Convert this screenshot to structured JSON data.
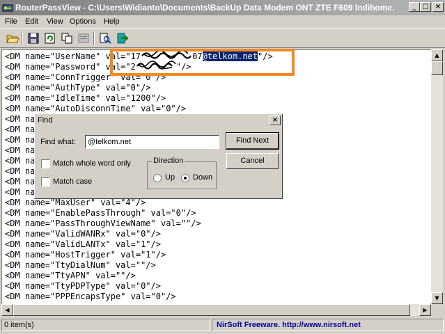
{
  "window": {
    "title": "RouterPassView  -  C:\\Users\\Widianto\\Documents\\BackUp Data Modem ONT ZTE F609  Indihome..."
  },
  "menu": [
    "File",
    "Edit",
    "View",
    "Options",
    "Help"
  ],
  "toolbar_icons": [
    "open-folder-icon",
    "save-icon",
    "refresh-icon",
    "copy-icon",
    "properties-icon",
    "find-icon",
    "exit-icon"
  ],
  "code_lines": [
    {
      "pre": "<DM name=\"UserName\" val=\"17",
      "post": "07",
      "match": "@telkom.net",
      "tail": "\"/>"
    },
    {
      "pre": "<DM name=\"Password\" val=\"2",
      "post": "",
      "match": "",
      "tail": "\"/>"
    },
    {
      "text": "<DM name=\"ConnTrigger\" val=\"0\"/>"
    },
    {
      "text": "<DM name=\"AuthType\" val=\"0\"/>"
    },
    {
      "text": "<DM name=\"IdleTime\" val=\"1200\"/>"
    },
    {
      "text": "<DM name=\"AutoDisconnTime\" val=\"0\"/>"
    },
    {
      "text": "<DM na"
    },
    {
      "text": "<DM na"
    },
    {
      "text": "<DM na"
    },
    {
      "text": "<DM na"
    },
    {
      "text": "<DM na"
    },
    {
      "text": "<DM na"
    },
    {
      "text": "<DM na"
    },
    {
      "text": "<DM na"
    },
    {
      "text": "<DM name=\"MaxUser\" val=\"4\"/>"
    },
    {
      "text": "<DM name=\"EnablePassThrough\" val=\"0\"/>"
    },
    {
      "text": "<DM name=\"PassThroughViewName\" val=\"\"/>"
    },
    {
      "text": "<DM name=\"ValidWANRx\" val=\"0\"/>"
    },
    {
      "text": "<DM name=\"ValidLANTx\" val=\"1\"/>"
    },
    {
      "text": "<DM name=\"HostTrigger\" val=\"1\"/>"
    },
    {
      "text": "<DM name=\"TtyDialNum\" val=\"\"/>"
    },
    {
      "text": "<DM name=\"TtyAPN\" val=\"\"/>"
    },
    {
      "text": "<DM name=\"TtyPDPType\" val=\"0\"/>"
    },
    {
      "text": "<DM name=\"PPPEncapsType\" val=\"0\"/>"
    }
  ],
  "find_dialog": {
    "title": "Find",
    "find_what_label": "Find what:",
    "find_what_value": "@telkom.net",
    "find_next_label": "Find Next",
    "cancel_label": "Cancel",
    "match_whole_word_label": "Match whole word only",
    "match_case_label": "Match case",
    "direction_label": "Direction",
    "up_label": "Up",
    "down_label": "Down",
    "selected_direction": "down"
  },
  "status": {
    "items": "0 item(s)",
    "link": "NirSoft Freeware.  http://www.nirsoft.net"
  },
  "colors": {
    "highlight": "#0a246a",
    "annotation": "#f08a24",
    "link": "#0000a0"
  }
}
